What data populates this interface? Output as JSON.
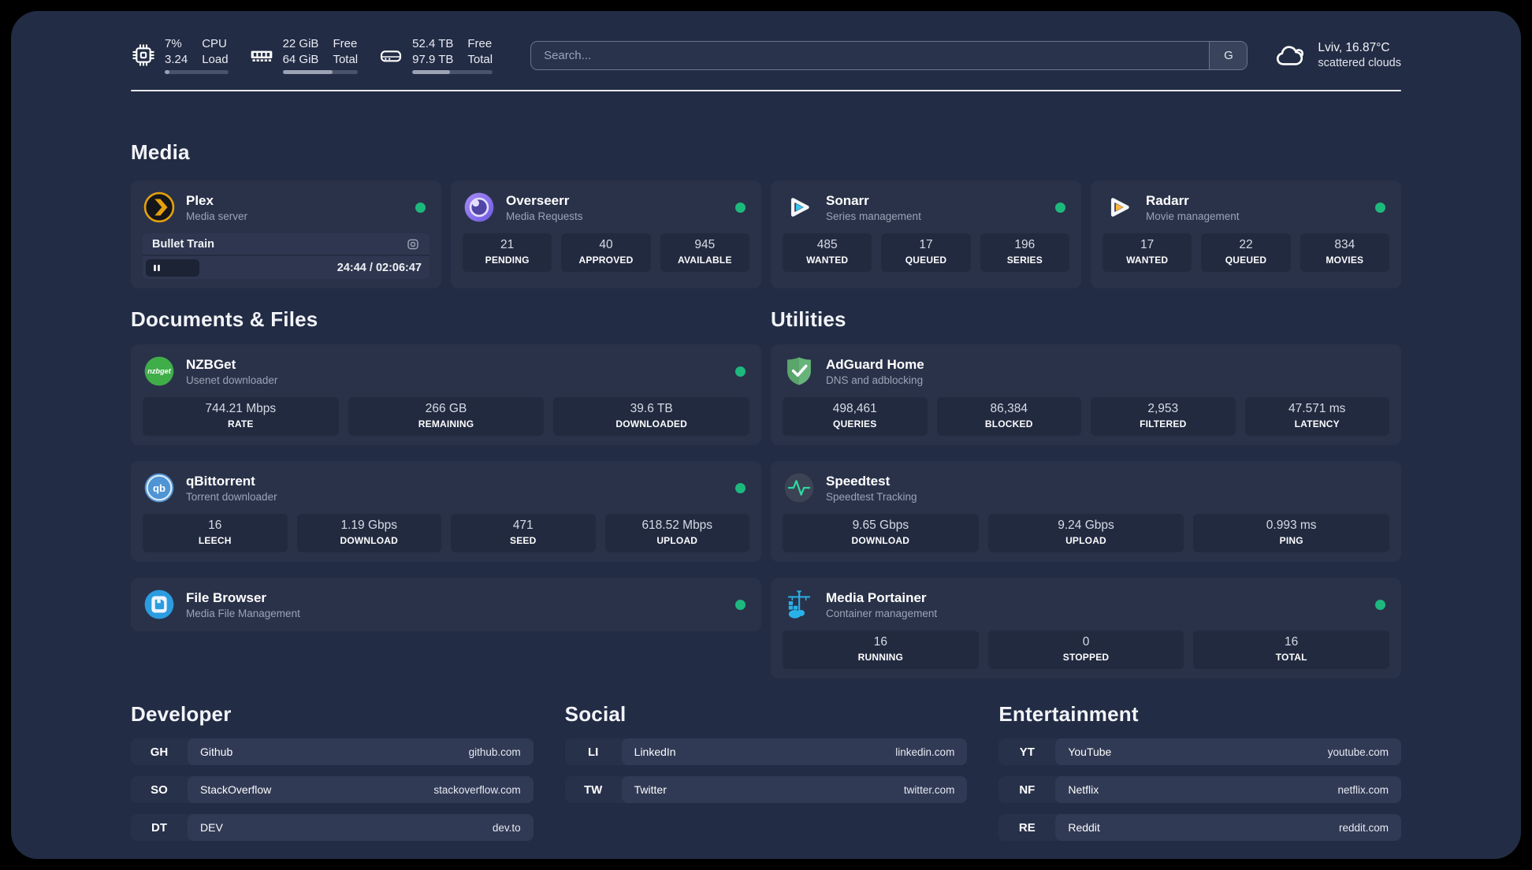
{
  "colors": {
    "background": "#232c45",
    "card": "#2a3249",
    "stat_tile": "#222a40",
    "status_online": "#1db87e",
    "plex_accent": "#e5a00d",
    "sonarr_accent": "#35c5f1",
    "radarr_accent": "#ffb53c",
    "speedtest_accent": "#2fd8a0",
    "portainer_accent": "#29b2e8"
  },
  "topbar": {
    "cpu": {
      "value_top": "7%",
      "value_bottom": "3.24",
      "label_top": "CPU",
      "label_bottom": "Load",
      "usage_percent": 7
    },
    "memory": {
      "value_top": "22 GiB",
      "value_bottom": "64 GiB",
      "label_top": "Free",
      "label_bottom": "Total",
      "usage_percent": 66
    },
    "storage": {
      "value_top": "52.4 TB",
      "value_bottom": "97.9 TB",
      "label_top": "Free",
      "label_bottom": "Total",
      "usage_percent": 47
    },
    "search": {
      "placeholder": "Search...",
      "button_label": "G"
    },
    "weather": {
      "location": "Lviv, 16.87°C",
      "condition": "scattered clouds"
    }
  },
  "sections": {
    "media": {
      "title": "Media",
      "cards": [
        {
          "name": "Plex",
          "subtitle": "Media server",
          "online": true,
          "now_playing": {
            "title": "Bullet Train",
            "time": "24:44 / 02:06:47",
            "progress_percent": 19.5
          }
        },
        {
          "name": "Overseerr",
          "subtitle": "Media Requests",
          "online": true,
          "stats": [
            {
              "value": "21",
              "label": "PENDING"
            },
            {
              "value": "40",
              "label": "APPROVED"
            },
            {
              "value": "945",
              "label": "AVAILABLE"
            }
          ]
        },
        {
          "name": "Sonarr",
          "subtitle": "Series management",
          "online": true,
          "stats": [
            {
              "value": "485",
              "label": "WANTED"
            },
            {
              "value": "17",
              "label": "QUEUED"
            },
            {
              "value": "196",
              "label": "SERIES"
            }
          ]
        },
        {
          "name": "Radarr",
          "subtitle": "Movie management",
          "online": true,
          "stats": [
            {
              "value": "17",
              "label": "WANTED"
            },
            {
              "value": "22",
              "label": "QUEUED"
            },
            {
              "value": "834",
              "label": "MOVIES"
            }
          ]
        }
      ]
    },
    "documents": {
      "title": "Documents & Files",
      "cards": [
        {
          "name": "NZBGet",
          "subtitle": "Usenet downloader",
          "online": true,
          "stats": [
            {
              "value": "744.21 Mbps",
              "label": "RATE"
            },
            {
              "value": "266 GB",
              "label": "REMAINING"
            },
            {
              "value": "39.6 TB",
              "label": "DOWNLOADED"
            }
          ]
        },
        {
          "name": "qBittorrent",
          "subtitle": "Torrent downloader",
          "online": true,
          "stats": [
            {
              "value": "16",
              "label": "LEECH"
            },
            {
              "value": "1.19 Gbps",
              "label": "DOWNLOAD"
            },
            {
              "value": "471",
              "label": "SEED"
            },
            {
              "value": "618.52 Mbps",
              "label": "UPLOAD"
            }
          ]
        },
        {
          "name": "File Browser",
          "subtitle": "Media File Management",
          "online": true,
          "stats": []
        }
      ]
    },
    "utilities": {
      "title": "Utilities",
      "cards": [
        {
          "name": "AdGuard Home",
          "subtitle": "DNS and adblocking",
          "online": false,
          "stats": [
            {
              "value": "498,461",
              "label": "QUERIES"
            },
            {
              "value": "86,384",
              "label": "BLOCKED"
            },
            {
              "value": "2,953",
              "label": "FILTERED"
            },
            {
              "value": "47.571 ms",
              "label": "LATENCY"
            }
          ]
        },
        {
          "name": "Speedtest",
          "subtitle": "Speedtest Tracking",
          "online": false,
          "stats": [
            {
              "value": "9.65 Gbps",
              "label": "DOWNLOAD"
            },
            {
              "value": "9.24 Gbps",
              "label": "UPLOAD"
            },
            {
              "value": "0.993 ms",
              "label": "PING"
            }
          ]
        },
        {
          "name": "Media Portainer",
          "subtitle": "Container management",
          "online": true,
          "stats": [
            {
              "value": "16",
              "label": "RUNNING"
            },
            {
              "value": "0",
              "label": "STOPPED"
            },
            {
              "value": "16",
              "label": "TOTAL"
            }
          ]
        }
      ]
    },
    "bookmarks": [
      {
        "title": "Developer",
        "links": [
          {
            "abbr": "GH",
            "name": "Github",
            "url": "github.com"
          },
          {
            "abbr": "SO",
            "name": "StackOverflow",
            "url": "stackoverflow.com"
          },
          {
            "abbr": "DT",
            "name": "DEV",
            "url": "dev.to"
          }
        ]
      },
      {
        "title": "Social",
        "links": [
          {
            "abbr": "LI",
            "name": "LinkedIn",
            "url": "linkedin.com"
          },
          {
            "abbr": "TW",
            "name": "Twitter",
            "url": "twitter.com"
          }
        ]
      },
      {
        "title": "Entertainment",
        "links": [
          {
            "abbr": "YT",
            "name": "YouTube",
            "url": "youtube.com"
          },
          {
            "abbr": "NF",
            "name": "Netflix",
            "url": "netflix.com"
          },
          {
            "abbr": "RE",
            "name": "Reddit",
            "url": "reddit.com"
          }
        ]
      }
    ]
  }
}
